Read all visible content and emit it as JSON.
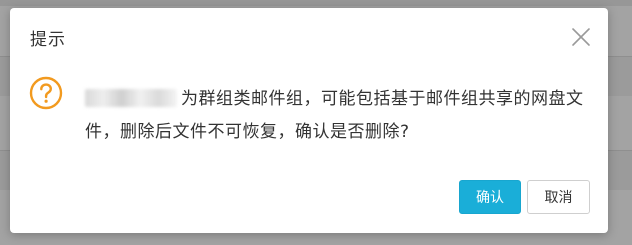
{
  "dialog": {
    "title": "提示",
    "message_text": "为群组类邮件组，可能包括基于邮件组共享的网盘文件，删除后文件不可恢复，确认是否删除?",
    "icon": "question-circle-icon",
    "close_icon": "close-icon",
    "confirm_label": "确认",
    "cancel_label": "取消"
  },
  "colors": {
    "accent": "#1aaed8",
    "warning": "#f29a1f",
    "overlay": "#a3a3a3",
    "text": "#333333"
  }
}
